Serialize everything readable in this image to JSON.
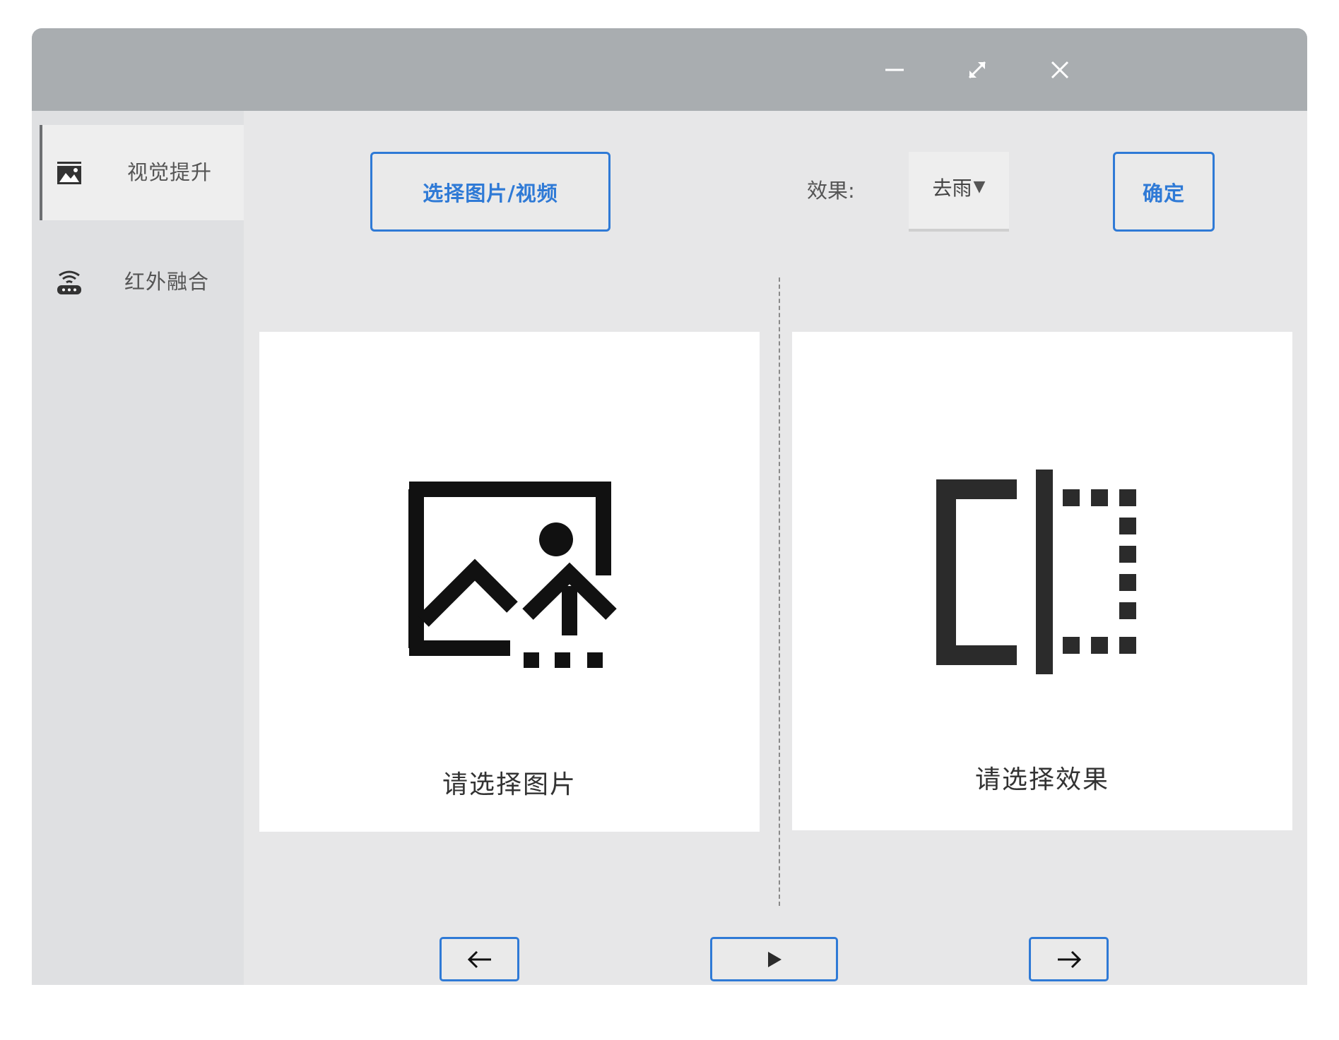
{
  "window": {
    "controls": {
      "minimize": "minimize-icon",
      "maximize": "expand-icon",
      "close": "close-icon"
    }
  },
  "sidebar": {
    "items": [
      {
        "label": "视觉提升",
        "icon": "image-icon",
        "active": true
      },
      {
        "label": "红外融合",
        "icon": "router-icon",
        "active": false
      }
    ]
  },
  "toolbar": {
    "select_button": "选择图片/视频",
    "effect_label": "效果:",
    "effect_value": "去雨",
    "confirm_button": "确定"
  },
  "panels": {
    "left_text": "请选择图片",
    "right_text": "请选择效果"
  },
  "nav": {
    "prev": "arrow-left-icon",
    "play": "play-icon",
    "next": "arrow-right-icon"
  },
  "colors": {
    "accent": "#2f7ad6",
    "titlebar": "#a9adb0",
    "sidebar": "#dfe0e2",
    "main": "#e7e7e8"
  }
}
